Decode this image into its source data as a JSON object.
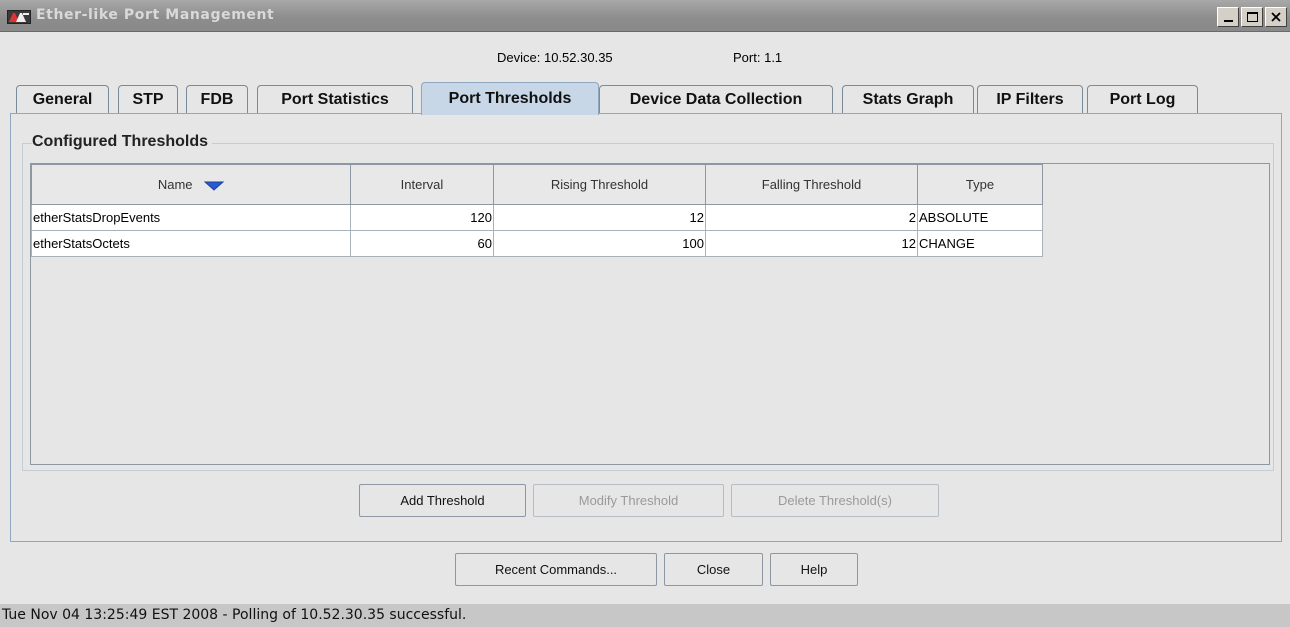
{
  "window": {
    "title": "Ether-like Port Management",
    "buttons": {
      "minimize": "_",
      "maximize": "□",
      "close": "×"
    }
  },
  "header": {
    "device_label": "Device:",
    "device_value": "10.52.30.35",
    "port_label": "Port:",
    "port_value": "1.1"
  },
  "tabs": [
    {
      "label": "General"
    },
    {
      "label": "STP"
    },
    {
      "label": "FDB"
    },
    {
      "label": "Port Statistics"
    },
    {
      "label": "Port Thresholds",
      "active": true
    },
    {
      "label": "Device Data Collection"
    },
    {
      "label": "Stats Graph"
    },
    {
      "label": "IP Filters"
    },
    {
      "label": "Port Log"
    }
  ],
  "thresholds": {
    "group_title": "Configured Thresholds",
    "columns": [
      "Name",
      "Interval",
      "Rising Threshold",
      "Falling Threshold",
      "Type"
    ],
    "sort_icon": "sort-descending-icon",
    "rows": [
      {
        "name": "etherStatsDropEvents",
        "interval": "120",
        "rising": "12",
        "falling": "2",
        "type": "ABSOLUTE"
      },
      {
        "name": "etherStatsOctets",
        "interval": "60",
        "rising": "100",
        "falling": "12",
        "type": "CHANGE"
      }
    ],
    "buttons": {
      "add": "Add Threshold",
      "modify": "Modify Threshold",
      "delete": "Delete Threshold(s)"
    }
  },
  "footer": {
    "recent": "Recent Commands...",
    "close": "Close",
    "help": "Help"
  },
  "status": "Tue Nov 04 13:25:49 EST 2008 - Polling of 10.52.30.35 successful.",
  "colors": {
    "active_tab": "#c7d7e8",
    "sort_arrow": "#2a5ad0",
    "titlebar": "#999999"
  }
}
